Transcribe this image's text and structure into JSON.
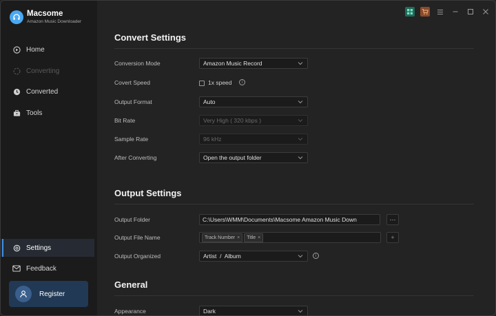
{
  "app": {
    "name": "Macsome",
    "subtitle": "Amazon Music Downloader"
  },
  "sidebar": {
    "items": [
      {
        "label": "Home",
        "icon": "home-icon",
        "state": "normal"
      },
      {
        "label": "Converting",
        "icon": "converting-icon",
        "state": "disabled"
      },
      {
        "label": "Converted",
        "icon": "clock-icon",
        "state": "normal"
      },
      {
        "label": "Tools",
        "icon": "toolbox-icon",
        "state": "normal"
      }
    ],
    "bottom_items": [
      {
        "label": "Settings",
        "icon": "gear-icon",
        "state": "active"
      },
      {
        "label": "Feedback",
        "icon": "mail-icon",
        "state": "normal"
      }
    ],
    "register_label": "Register"
  },
  "titlebar": {
    "icons": [
      "store-icon",
      "cart-icon",
      "menu-icon",
      "minimize-icon",
      "maximize-icon",
      "close-icon"
    ]
  },
  "convert_settings": {
    "title": "Convert Settings",
    "conversion_mode": {
      "label": "Conversion Mode",
      "value": "Amazon Music Record"
    },
    "convert_speed": {
      "label": "Covert Speed",
      "option": "1x speed",
      "checked": false
    },
    "output_format": {
      "label": "Output Format",
      "value": "Auto"
    },
    "bit_rate": {
      "label": "Bit Rate",
      "value": "Very High ( 320 kbps )"
    },
    "sample_rate": {
      "label": "Sample Rate",
      "value": "96 kHz"
    },
    "after_converting": {
      "label": "After Converting",
      "value": "Open the output folder"
    }
  },
  "output_settings": {
    "title": "Output Settings",
    "output_folder": {
      "label": "Output Folder",
      "value": "C:\\Users\\WMM\\Documents\\Macsome Amazon Music Down",
      "browse": "···"
    },
    "output_file_name": {
      "label": "Output File Name",
      "tags": [
        "Track Number",
        "Title"
      ],
      "add": "+"
    },
    "output_organized": {
      "label": "Output Organized",
      "value": "Artist  /  Album"
    }
  },
  "general": {
    "title": "General",
    "appearance": {
      "label": "Appearance",
      "value": "Dark"
    }
  },
  "colors": {
    "accent": "#3f8ee8",
    "sidebar_bg": "#1b1b1b",
    "main_bg": "#232323",
    "register_bg": "#213955"
  }
}
